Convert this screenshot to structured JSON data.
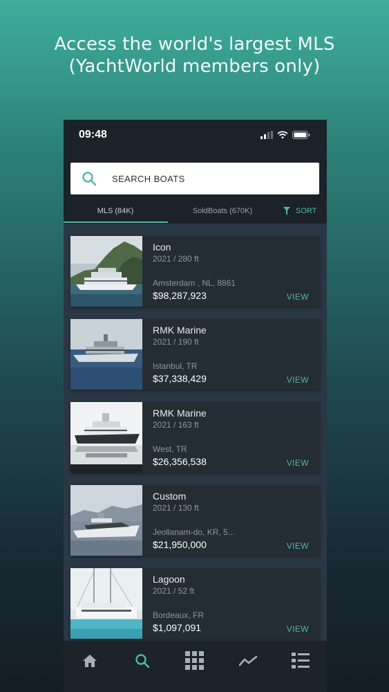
{
  "headline": {
    "line1": "Access the world's largest MLS",
    "line2": "(YachtWorld members only)"
  },
  "status_bar": {
    "time": "09:48"
  },
  "search": {
    "label": "SEARCH BOATS"
  },
  "tabs": [
    {
      "label": "MLS (84K)",
      "active": true
    },
    {
      "label": "SoldBoats (670K)",
      "active": false
    }
  ],
  "sort": {
    "label": "SORT"
  },
  "listings": [
    {
      "title": "Icon",
      "sub": "2021 / 280 ft",
      "location": "Amsterdam , NL, 8861",
      "price": "$98,287,923",
      "action": "VIEW"
    },
    {
      "title": "RMK Marine",
      "sub": "2021 / 190 ft",
      "location": "Istanbul, TR",
      "price": "$37,338,429",
      "action": "VIEW"
    },
    {
      "title": "RMK Marine",
      "sub": "2021 / 163 ft",
      "location": "West, TR",
      "price": "$26,356,538",
      "action": "VIEW"
    },
    {
      "title": "Custom",
      "sub": "2021 / 130 ft",
      "location": "Jeollanam-do, KR, 5...",
      "price": "$21,950,000",
      "action": "VIEW"
    },
    {
      "title": "Lagoon",
      "sub": "2021 / 52 ft",
      "location": "Bordeaux, FR",
      "price": "$1,097,091",
      "action": "VIEW"
    }
  ],
  "bottom_nav": [
    {
      "icon": "home-icon",
      "active": false
    },
    {
      "icon": "search-icon",
      "active": true
    },
    {
      "icon": "grid-icon",
      "active": false
    },
    {
      "icon": "trend-icon",
      "active": false
    },
    {
      "icon": "list-icon",
      "active": false
    }
  ],
  "colors": {
    "accent": "#4fb9a5",
    "card": "#242c34",
    "list_bg": "#2a3744",
    "nav_bg": "#1c232a"
  }
}
